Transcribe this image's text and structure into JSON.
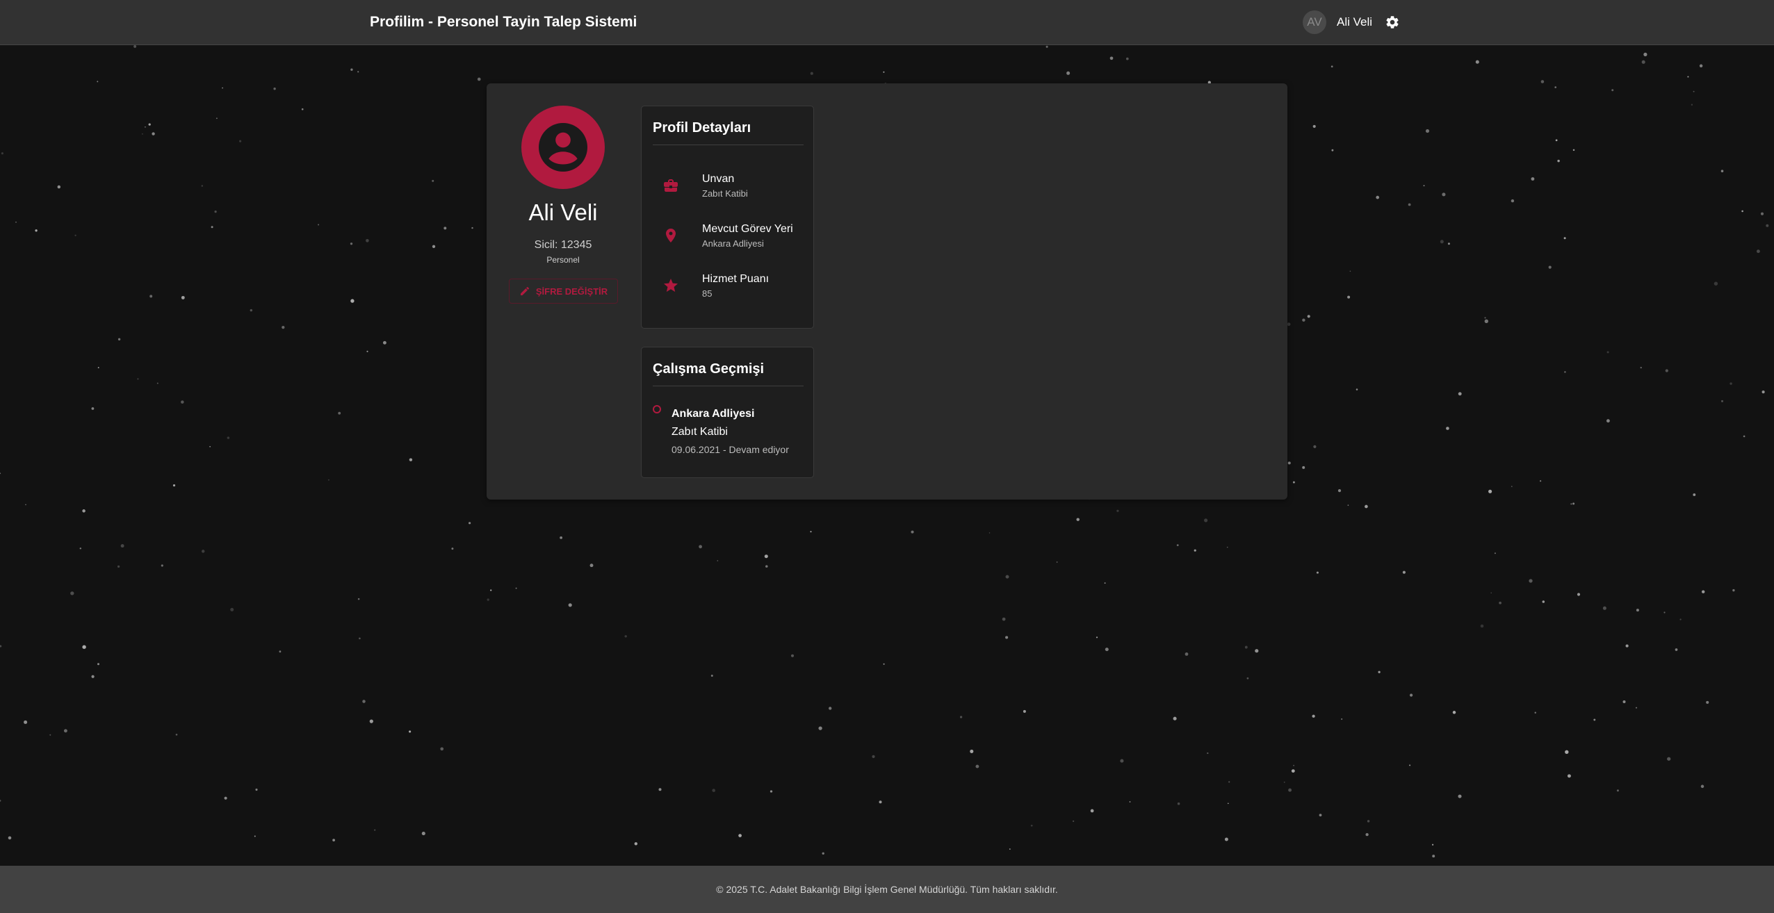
{
  "header": {
    "title": "Profilim - Personel Tayin Talep Sistemi",
    "user_initials": "AV",
    "user_name": "Ali Veli"
  },
  "profile": {
    "name": "Ali Veli",
    "sicil": "Sicil: 12345",
    "role": "Personel",
    "change_password_label": "ŞİFRE DEĞİŞTİR"
  },
  "details": {
    "title": "Profil Detayları",
    "items": [
      {
        "label": "Unvan",
        "value": "Zabıt Katibi",
        "icon": "briefcase-icon"
      },
      {
        "label": "Mevcut Görev Yeri",
        "value": "Ankara Adliyesi",
        "icon": "location-pin-icon"
      },
      {
        "label": "Hizmet Puanı",
        "value": "85",
        "icon": "star-icon"
      }
    ]
  },
  "history": {
    "title": "Çalışma Geçmişi",
    "entries": [
      {
        "place": "Ankara Adliyesi",
        "role": "Zabıt Katibi",
        "date": "09.06.2021 - Devam ediyor"
      }
    ]
  },
  "footer": {
    "text": "© 2025 T.C. Adalet Bakanlığı Bilgi İşlem Genel Müdürlüğü. Tüm hakları saklıdır."
  },
  "colors": {
    "accent": "#b11a3f",
    "background": "#121212",
    "appbar": "#323232",
    "card": "#2a2a2a",
    "panel": "#1e1e1e",
    "footer": "#424242"
  }
}
